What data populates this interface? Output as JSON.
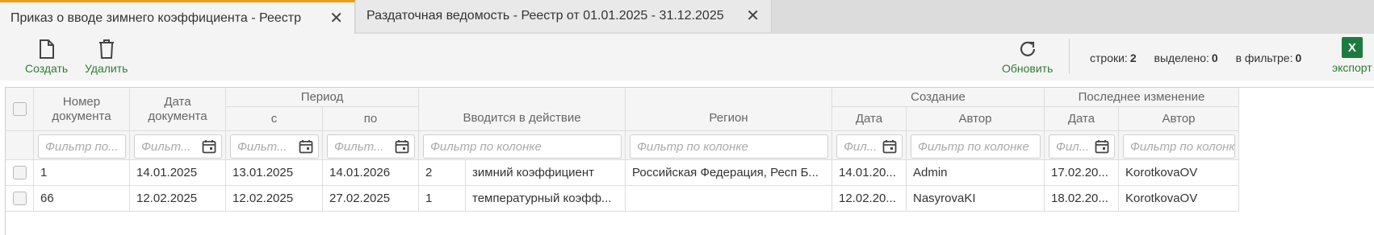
{
  "tabs": [
    {
      "label": "Приказ о вводе зимнего коэффициента - Реестр",
      "active": true
    },
    {
      "label": "Раздаточная ведомость - Реестр от 01.01.2025 - 31.12.2025",
      "active": false
    }
  ],
  "toolbar": {
    "create_label": "Создать",
    "delete_label": "Удалить",
    "refresh_label": "Обновить",
    "export_label": "экспорт",
    "excel_letter": "X",
    "rows_label": "строки:",
    "rows_value": "2",
    "selected_label": "выделено:",
    "selected_value": "0",
    "filtered_label": "в фильтре:",
    "filtered_value": "0"
  },
  "colors": {
    "accent_green": "#2e7d32",
    "active_tab_border": "#f39c12",
    "excel_green": "#1d7b3f"
  },
  "grid": {
    "headers": {
      "doc_number": "Номер документа",
      "doc_date": "Дата документа",
      "period": "Период",
      "period_from": "с",
      "period_to": "по",
      "effective": "Вводится в действие",
      "region": "Регион",
      "creation": "Создание",
      "creation_date": "Дата",
      "creation_author": "Автор",
      "last_change": "Последнее изменение",
      "change_date": "Дата",
      "change_author": "Автор"
    },
    "filters": {
      "doc_number": "Фильтр по...",
      "doc_date": "Фильт...",
      "period_from": "Фильт...",
      "period_to": "Фильт...",
      "effective": "Фильтр по колонке",
      "region": "Фильтр по колонке",
      "creation_date": "Фил...",
      "creation_author": "Фильтр по колонке",
      "change_date": "Фил...",
      "change_author": "Фильтр по колонке"
    },
    "rows": [
      {
        "number": "1",
        "doc_date": "14.01.2025",
        "from": "13.01.2025",
        "to": "14.01.2026",
        "eff_num": "2",
        "eff_name": "зимний коэффициент",
        "region": "Российская Федерация, Респ Б...",
        "created_date": "14.01.20...",
        "created_author": "Admin",
        "changed_date": "17.02.20...",
        "changed_author": "KorotkovaOV"
      },
      {
        "number": "66",
        "doc_date": "12.02.2025",
        "from": "12.02.2025",
        "to": "27.02.2025",
        "eff_num": "1",
        "eff_name": "температурный коэфф...",
        "region": "",
        "created_date": "12.02.20...",
        "created_author": "NasyrovaKI",
        "changed_date": "18.02.20...",
        "changed_author": "KorotkovaOV"
      }
    ]
  }
}
